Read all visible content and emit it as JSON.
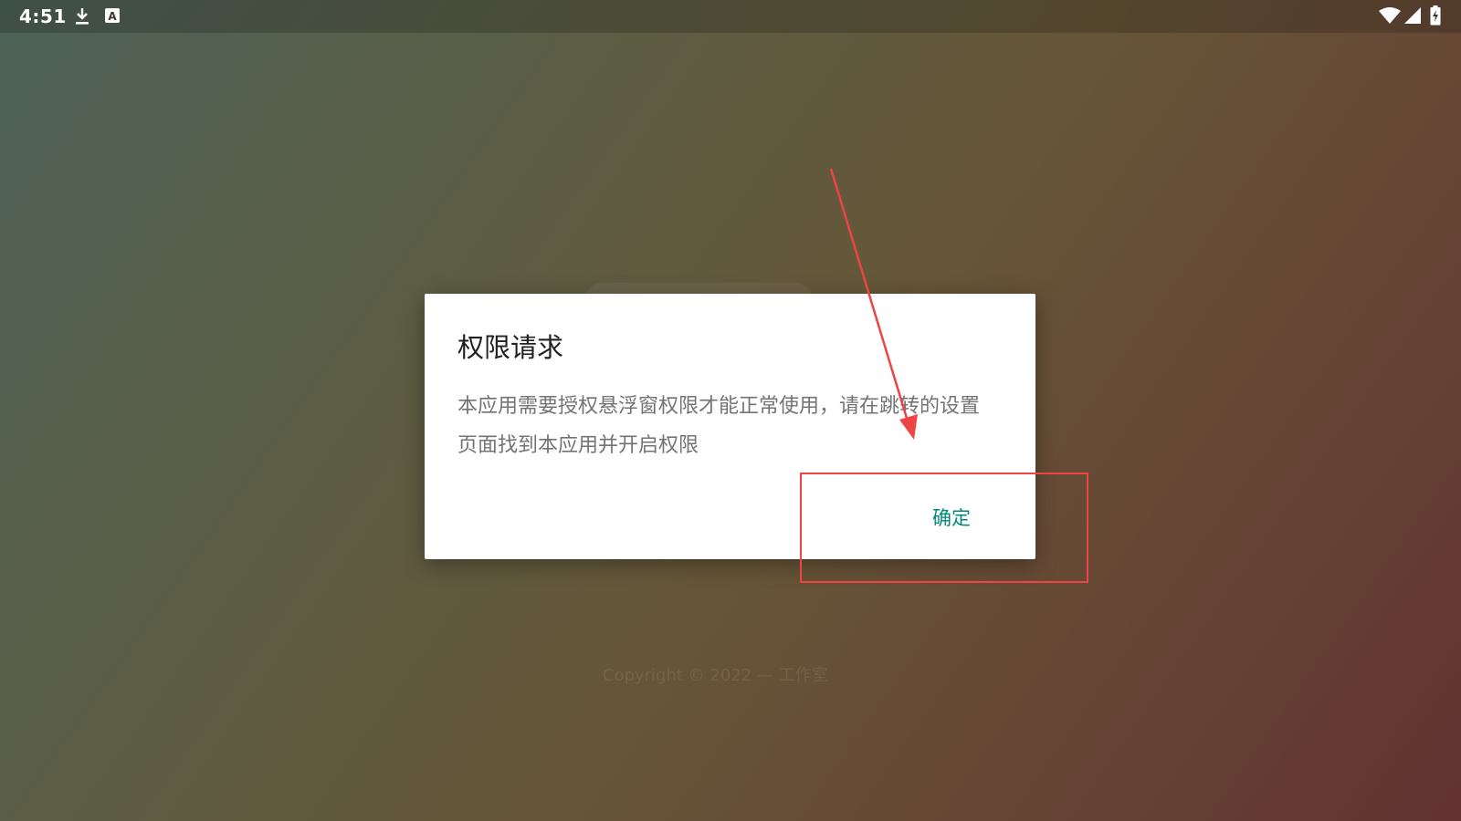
{
  "status_bar": {
    "time": "4:51",
    "left_icons": [
      "download-icon",
      "a-notification-icon"
    ],
    "right_icons": [
      "wifi-icon",
      "signal-icon",
      "battery-charging-icon"
    ]
  },
  "background": {
    "copyright": "Copyright © 2022 — 工作室"
  },
  "dialog": {
    "title": "权限请求",
    "message": "本应用需要授权悬浮窗权限才能正常使用，请在跳转的设置页面找到本应用并开启权限",
    "confirm_label": "确定"
  },
  "colors": {
    "accent": "#00897b",
    "annotation": "#ee4444",
    "dialog_bg": "#ffffff"
  }
}
